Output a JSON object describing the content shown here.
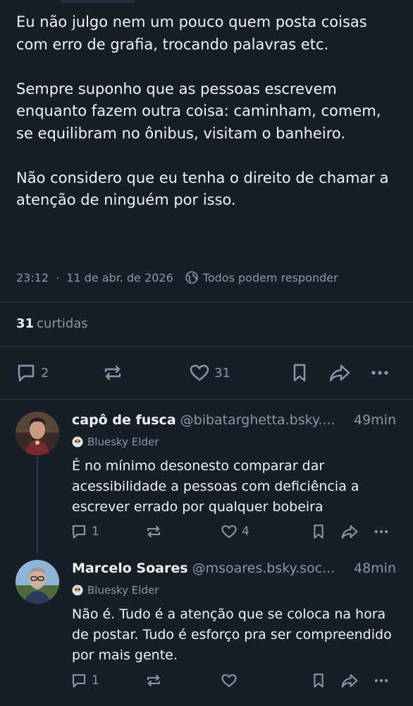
{
  "post": {
    "paragraphs": [
      "Eu não julgo nem um pouco quem posta coisas com erro de grafia, trocando palavras etc.",
      "Sempre suponho que as pessoas escrevem enquanto fazem outra coisa: caminham, comem, se equilibram no ônibus, visitam o banheiro.",
      "Não considero que eu tenha o direito de chamar a atenção de ninguém por isso."
    ],
    "time": "23:12",
    "date": "11 de abr. de 2026",
    "reply_setting": "Todos podem responder",
    "likes_count": "31",
    "likes_label": "curtidas",
    "actions": {
      "replies": "2",
      "likes": "31"
    }
  },
  "replies": [
    {
      "display_name": "capô de fusca",
      "handle": "@bibatarghetta.bsky....",
      "time": "49min",
      "badge": "Bluesky Elder",
      "text": "É no mínimo desonesto comparar dar acessibilidade a pessoas com deficiência a escrever errado por qualquer bobeira",
      "reply_count": "1",
      "like_count": "4"
    },
    {
      "display_name": "Marcelo Soares",
      "handle": "@msoares.bsky.soc...",
      "time": "48min",
      "badge": "Bluesky Elder",
      "text": "Não é. Tudo é a atenção que se coloca na hora de postar. Tudo é esforço pra ser compreendido por mais gente.",
      "reply_count": "1",
      "like_count": ""
    }
  ],
  "colors": {
    "background": "#161e27",
    "text": "#f1f3f5",
    "muted": "#8c98a5",
    "divider": "#2c3845"
  }
}
